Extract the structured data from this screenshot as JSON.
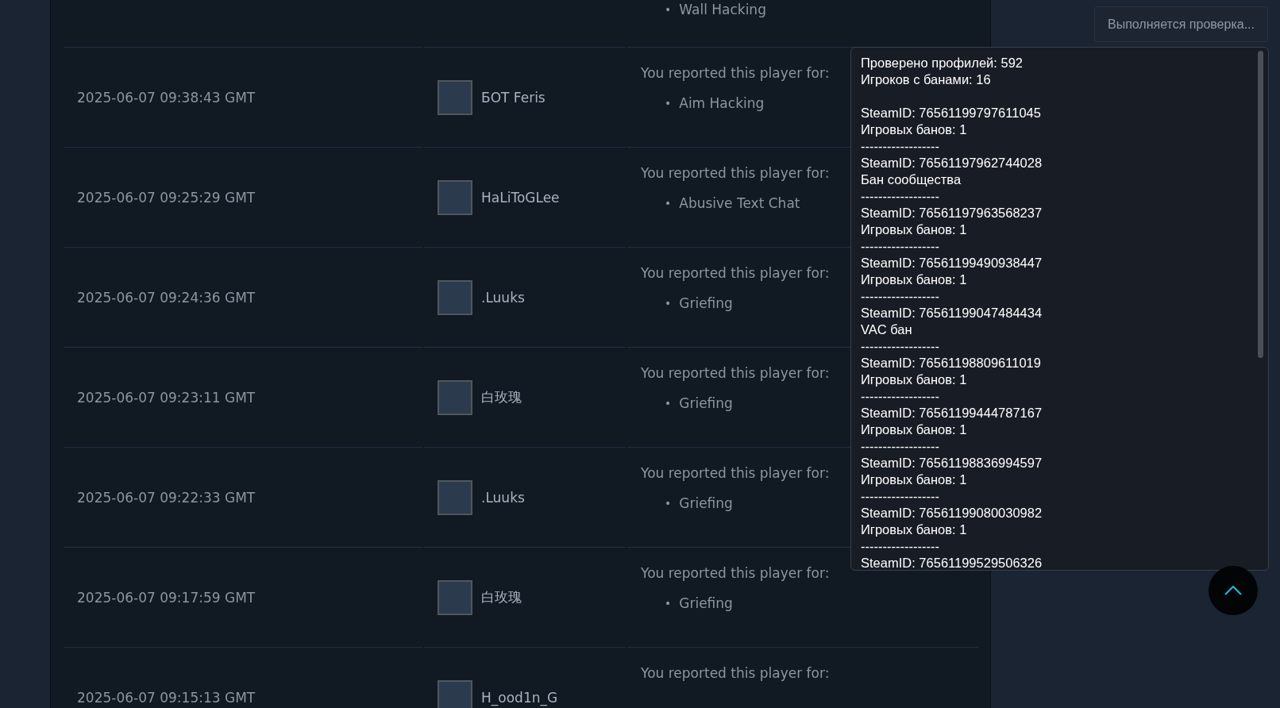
{
  "reports": [
    {
      "kind": "partial",
      "reasons": [
        {
          "marker": "•",
          "text": "Wall Hacking"
        }
      ]
    },
    {
      "kind": "full",
      "date": "2025-06-07 09:38:43 GMT",
      "player": "БОТ Feris",
      "reported_label": "You reported this player for:",
      "reasons": [
        {
          "marker": "•",
          "text": "Aim Hacking"
        }
      ]
    },
    {
      "kind": "full",
      "date": "2025-06-07 09:25:29 GMT",
      "player": "HaLiToGLee",
      "reported_label": "You reported this player for:",
      "reasons": [
        {
          "marker": "•",
          "text": "Abusive Text Chat"
        }
      ]
    },
    {
      "kind": "full",
      "date": "2025-06-07 09:24:36 GMT",
      "player": ".Luuks",
      "reported_label": "You reported this player for:",
      "reasons": [
        {
          "marker": "•",
          "text": "Griefing"
        }
      ]
    },
    {
      "kind": "full",
      "date": "2025-06-07 09:23:11 GMT",
      "player": "白玫瑰",
      "reported_label": "You reported this player for:",
      "reasons": [
        {
          "marker": "•",
          "text": "Griefing"
        }
      ]
    },
    {
      "kind": "full",
      "date": "2025-06-07 09:22:33 GMT",
      "player": ".Luuks",
      "reported_label": "You reported this player for:",
      "reasons": [
        {
          "marker": "•",
          "text": "Griefing"
        }
      ]
    },
    {
      "kind": "full",
      "date": "2025-06-07 09:17:59 GMT",
      "player": "白玫瑰",
      "reported_label": "You reported this player for:",
      "reasons": [
        {
          "marker": "•",
          "text": "Griefing"
        }
      ]
    },
    {
      "kind": "full",
      "date": "2025-06-07 09:15:13 GMT",
      "player": "H_ood1n_G",
      "reported_label": "You reported this player for:"
    }
  ],
  "status_button": {
    "label": "Выполняется проверка..."
  },
  "results_popup": {
    "summary": [
      "Проверено профилей: 592",
      "Игроков с банами: 16"
    ],
    "entries": [
      {
        "steam_id": "SteamID: 76561199797611045",
        "detail": "Игровых банов: 1",
        "separator": "------------------"
      },
      {
        "steam_id": "SteamID: 76561197962744028",
        "detail": "Бан сообщества",
        "separator": "------------------"
      },
      {
        "steam_id": "SteamID: 76561197963568237",
        "detail": "Игровых банов: 1",
        "separator": "------------------"
      },
      {
        "steam_id": "SteamID: 76561199490938447",
        "detail": "Игровых банов: 1",
        "separator": "------------------"
      },
      {
        "steam_id": "SteamID: 76561199047484434",
        "detail": "VAC бан",
        "separator": "------------------"
      },
      {
        "steam_id": "SteamID: 76561198809611019",
        "detail": "Игровых банов: 1",
        "separator": "------------------"
      },
      {
        "steam_id": "SteamID: 76561199444787167",
        "detail": "Игровых банов: 1",
        "separator": "------------------"
      },
      {
        "steam_id": "SteamID: 76561198836994597",
        "detail": "Игровых банов: 1",
        "separator": "------------------"
      },
      {
        "steam_id": "SteamID: 76561199080030982",
        "detail": "Игровых банов: 1",
        "separator": "------------------"
      },
      {
        "steam_id": "SteamID: 76561199529506326"
      }
    ]
  }
}
